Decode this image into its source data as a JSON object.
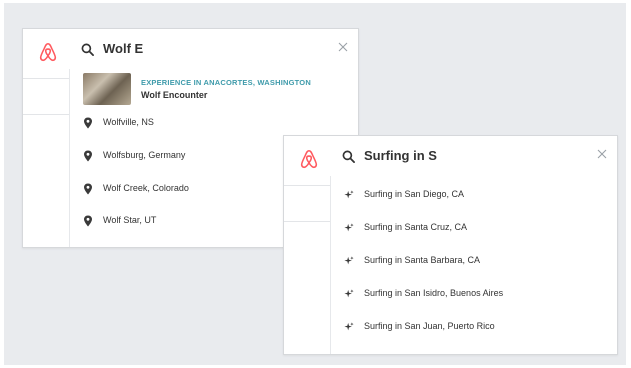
{
  "colors": {
    "brand": "#ff5a5f",
    "experience_accent": "#3f9bab",
    "text": "#333333",
    "background": "#e9ebee"
  },
  "card1": {
    "query": "Wolf E",
    "experience": {
      "kicker": "EXPERIENCE IN ANACORTES, WASHINGTON",
      "title": "Wolf Encounter",
      "thumb_icon": "wolf-photo-thumbnail"
    },
    "items": [
      {
        "label": "Wolfville, NS",
        "icon": "location-pin-icon"
      },
      {
        "label": "Wolfsburg, Germany",
        "icon": "location-pin-icon"
      },
      {
        "label": "Wolf Creek, Colorado",
        "icon": "location-pin-icon"
      },
      {
        "label": "Wolf Star, UT",
        "icon": "location-pin-icon"
      }
    ]
  },
  "card2": {
    "query": "Surfing in S",
    "items": [
      {
        "label": "Surfing in San Diego, CA",
        "icon": "sparkle-icon"
      },
      {
        "label": "Surfing in Santa Cruz, CA",
        "icon": "sparkle-icon"
      },
      {
        "label": "Surfing in Santa Barbara, CA",
        "icon": "sparkle-icon"
      },
      {
        "label": "Surfing in San Isidro, Buenos Aires",
        "icon": "sparkle-icon"
      },
      {
        "label": "Surfing in San Juan, Puerto Rico",
        "icon": "sparkle-icon"
      }
    ]
  }
}
